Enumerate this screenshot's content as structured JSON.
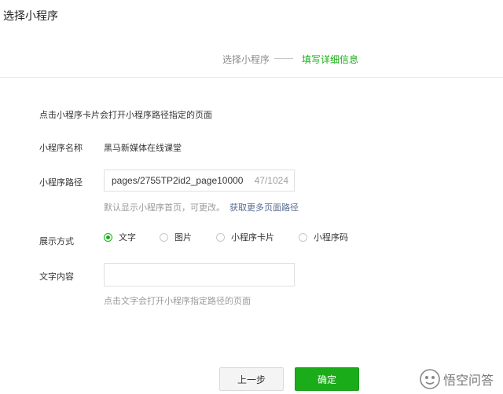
{
  "dialog": {
    "title": "选择小程序"
  },
  "steps": {
    "step1": "选择小程序",
    "step2": "填写详细信息"
  },
  "form": {
    "intro_hint": "点击小程序卡片会打开小程序路径指定的页面",
    "name_label": "小程序名称",
    "name_value": "黑马新媒体在线课堂",
    "path_label": "小程序路径",
    "path_value": "pages/2755TP2id2_page10000",
    "path_counter": "47/1024",
    "path_hint": "默认显示小程序首页，可更改。",
    "path_link": "获取更多页面路径",
    "display_label": "展示方式",
    "display_options": [
      "文字",
      "图片",
      "小程序卡片",
      "小程序码"
    ],
    "display_selected": "文字",
    "text_label": "文字内容",
    "text_value": "",
    "text_hint": "点击文字会打开小程序指定路径的页面"
  },
  "buttons": {
    "prev": "上一步",
    "confirm": "确定"
  },
  "watermark": {
    "text": "悟空问答"
  },
  "colors": {
    "accent": "#1aad19",
    "link": "#576b95"
  }
}
